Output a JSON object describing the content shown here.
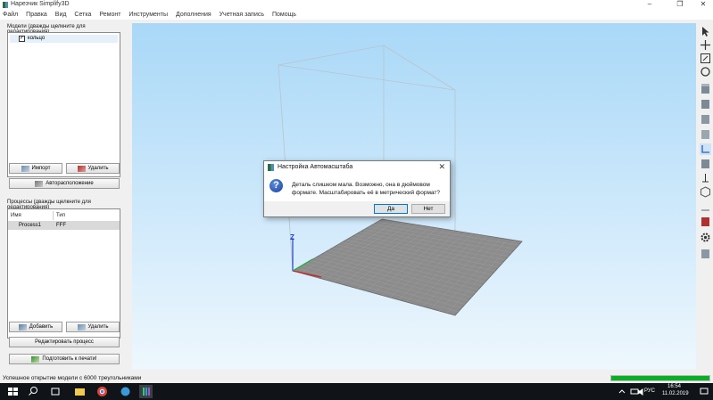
{
  "window": {
    "title": "Нарезчик Simplify3D"
  },
  "menu": [
    "Файл",
    "Правка",
    "Вид",
    "Сетка",
    "Ремонт",
    "Инструменты",
    "Дополнения",
    "Учетная запись",
    "Помощь"
  ],
  "models": {
    "label": "Модели (дважды щелкните для редактирования)",
    "items": [
      {
        "name": "кольцо",
        "checked": true
      }
    ],
    "import_button": "Импорт",
    "delete_button": "Удалить",
    "autoarrange_button": "Авторасположение"
  },
  "processes": {
    "label": "Процессы (дважды щелкните для редактирования)",
    "columns": [
      "Имя",
      "Тип"
    ],
    "rows": [
      {
        "name": "Process1",
        "type": "FFF"
      }
    ],
    "add_button": "Добавить",
    "delete_button": "Удалить",
    "edit_button": "Редактировать процесс",
    "prepare_button": "Подготовить к печати!"
  },
  "dialog": {
    "title": "Настройка Автомасштаба",
    "message": "Деталь слишком мала. Возможно, она в дюймовом формате. Масштабировать её в метрический формат?",
    "yes_button": "Да",
    "no_button": "Нет"
  },
  "viewport": {
    "axis_label": "Z"
  },
  "status": {
    "message": "Успешное открытие модели с 6000 треугольниками",
    "progress": 1.0
  },
  "taskbar": {
    "language": "РУС",
    "time": "16:54",
    "date": "11.02.2019"
  },
  "colors": {
    "viewport_top": "#a9d8f7",
    "bed": "#8c8c8c",
    "progress": "#06b025",
    "taskbar": "#101418"
  }
}
